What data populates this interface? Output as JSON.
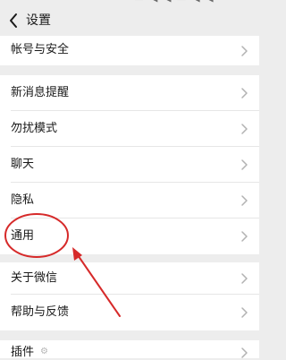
{
  "header": {
    "title": "设置",
    "back_icon": "chevron-left-icon"
  },
  "settings": {
    "account_security": "帐号与安全",
    "new_message_alert": "新消息提醒",
    "do_not_disturb": "勿扰模式",
    "chat": "聊天",
    "privacy": "隐私",
    "general": "通用",
    "about_wechat": "关于微信",
    "help_feedback": "帮助与反馈",
    "plugins": "插件"
  },
  "colors": {
    "background": "#ededed",
    "row_background": "#ffffff",
    "annotation": "#d62a2a",
    "chevron": "#b2b2b2"
  }
}
